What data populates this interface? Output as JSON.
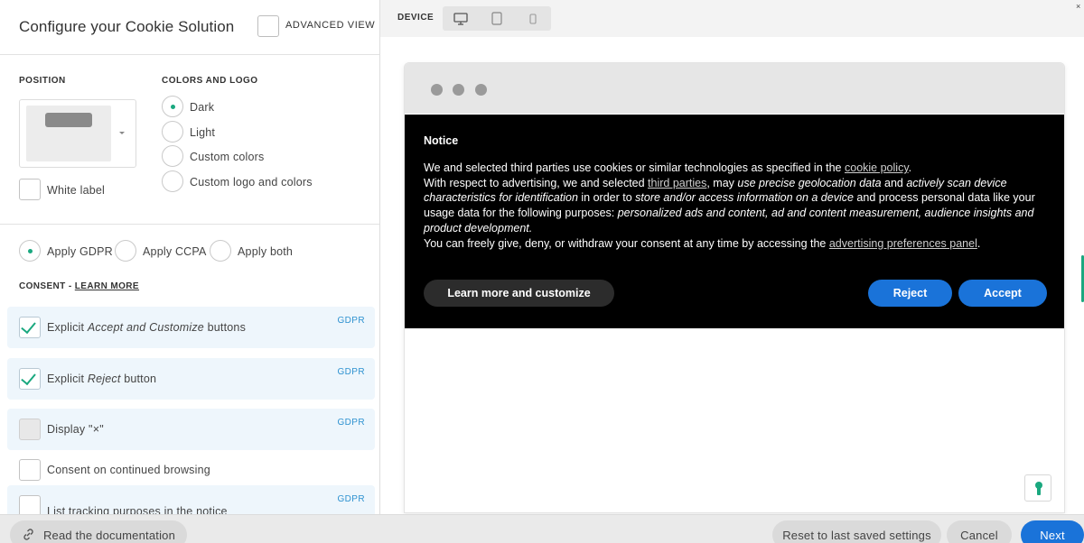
{
  "header": {
    "title": "Configure your Cookie Solution",
    "advanced_view_label": "ADVANCED VIEW"
  },
  "position": {
    "caption": "POSITION"
  },
  "colors": {
    "caption": "COLORS AND LOGO",
    "options": [
      "Dark",
      "Light",
      "Custom colors",
      "Custom logo and colors"
    ],
    "selected": "Dark"
  },
  "white_label": "White label",
  "regulation": {
    "options": [
      "Apply GDPR",
      "Apply CCPA",
      "Apply both"
    ],
    "selected": "Apply GDPR"
  },
  "consent": {
    "caption": "CONSENT - ",
    "learn_more": "LEARN MORE",
    "rows": [
      {
        "pre": "Explicit ",
        "em": "Accept and Customize",
        "post": " buttons",
        "tag": "GDPR",
        "checked": true
      },
      {
        "pre": "Explicit ",
        "em": "Reject",
        "post": " button",
        "tag": "GDPR",
        "checked": true
      },
      {
        "label": "Display \"×\"",
        "tag": "GDPR",
        "checked": false
      },
      {
        "label": "Consent on continued browsing",
        "tag": "",
        "checked": false
      },
      {
        "label": "List tracking purposes in the notice",
        "tag": "GDPR",
        "checked": false
      }
    ]
  },
  "device": {
    "label": "DEVICE",
    "options": [
      "desktop-icon",
      "tablet-icon",
      "mobile-icon"
    ]
  },
  "notice": {
    "title": "Notice",
    "p1a": "We and selected third parties use cookies or similar technologies as specified in the ",
    "p1_link": "cookie policy",
    "p1b": ".",
    "p2a": "With respect to advertising, we and selected ",
    "p2_link": "third parties",
    "p2b": ", may ",
    "p2_em1": "use precise geolocation data",
    "p2c": " and ",
    "p2_em2": "actively scan device characteristics for identification",
    "p2d": " in order to ",
    "p2_em3": "store and/or access information on a device",
    "p2e": " and process personal data like your usage data for the following purposes: ",
    "p2_em4": "personalized ads and content, ad and content measurement, audience insights and product development.",
    "p3a": "You can freely give, deny, or withdraw your consent at any time by accessing the ",
    "p3_link": "advertising preferences panel",
    "p3b": ".",
    "learn_more_button": "Learn more and customize",
    "reject_button": "Reject",
    "accept_button": "Accept"
  },
  "footer": {
    "docs_button": "Read the documentation",
    "reset_button": "Reset to last saved settings",
    "cancel_button": "Cancel",
    "next_button": "Next"
  },
  "colors_hex": {
    "accent": "#1aa87f",
    "primary": "#1a73d9",
    "notice_bg": "#000000",
    "gdpr_tag": "#2e92d0"
  }
}
